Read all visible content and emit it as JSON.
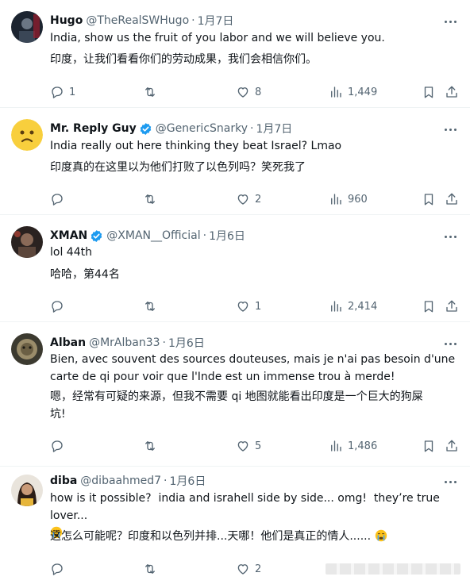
{
  "tweets": [
    {
      "name": "Hugo",
      "handle": "@TheRealSWHugo",
      "dot": "·",
      "date": "1月7日",
      "verified": false,
      "text_en": "India, show us the fruit of you labor and we will believe you.",
      "text_zh": "印度，让我们看看你们的劳动成果，我们会相信你们。",
      "replies": "1",
      "retweets": "",
      "likes": "8",
      "views": "1,449"
    },
    {
      "name": "Mr. Reply Guy",
      "handle": "@GenericSnarky",
      "dot": "·",
      "date": "1月7日",
      "verified": true,
      "text_en": "India really out here thinking they beat Israel? Lmao",
      "text_zh": "印度真的在这里以为他们打败了以色列吗？笑死我了",
      "replies": "",
      "retweets": "",
      "likes": "2",
      "views": "960"
    },
    {
      "name": "XMAN",
      "handle": "@XMAN__Official",
      "dot": "·",
      "date": "1月6日",
      "verified": true,
      "text_en": "lol 44th",
      "text_zh": "哈哈，第44名",
      "replies": "",
      "retweets": "",
      "likes": "1",
      "views": "2,414"
    },
    {
      "name": "Alban",
      "handle": "@MrAlban33",
      "dot": "·",
      "date": "1月6日",
      "verified": false,
      "text_en": "Bien, avec souvent des sources douteuses, mais je n'ai pas besoin d'une\ncarte de qi pour voir que l'Inde est un immense trou à merde!",
      "text_zh": "嗯，经常有可疑的来源，但我不需要 qi 地图就能看出印度是一个巨大的狗屎\n坑!",
      "replies": "",
      "retweets": "",
      "likes": "5",
      "views": "1,486"
    },
    {
      "name": "diba",
      "handle": "@dibaahmed7",
      "dot": "·",
      "date": "1月6日",
      "verified": false,
      "text_en": "how is it possible?  india and israhell side by side... omg!  they’re true lover...",
      "text_zh": "这怎么可能呢？印度和以色列并排...天哪！他们是真正的情人......",
      "replies": "",
      "retweets": "",
      "likes": "2",
      "views": ""
    }
  ],
  "icons": {
    "reply": "reply-icon",
    "retweet": "retweet-icon",
    "like": "heart-icon",
    "views": "views-icon",
    "bookmark": "bookmark-icon",
    "share": "share-icon",
    "more": "more-icon",
    "verified": "verified-badge-icon",
    "crying_emoji": "crying-face-icon"
  },
  "colors": {
    "verified": "#1d9bf0",
    "secondary_text": "#536471",
    "primary_text": "#0f1419"
  }
}
